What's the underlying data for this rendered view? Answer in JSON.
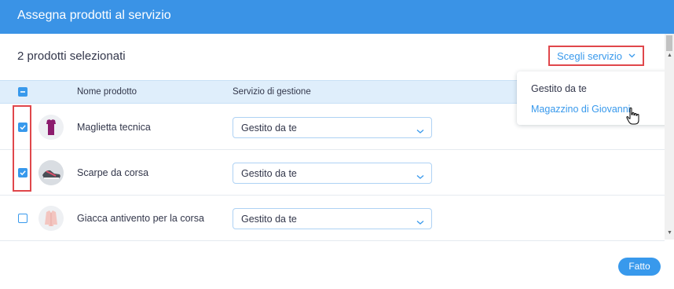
{
  "dialog": {
    "title": "Assegna prodotti al servizio",
    "selected_count": "2 prodotti selezionati",
    "choose_service_label": "Scegli servizio",
    "done_label": "Fatto"
  },
  "dropdown": {
    "options": [
      "Gestito da te",
      "Magazzino di Giovanni"
    ],
    "hovered": "Magazzino di Giovanni"
  },
  "table": {
    "headers": {
      "product": "Nome prodotto",
      "service": "Servizio di gestione"
    },
    "header_checkbox_state": "indeterminate",
    "rows": [
      {
        "name": "Maglietta tecnica",
        "service": "Gestito da te",
        "checked": true,
        "thumb_icon": "tshirt-icon"
      },
      {
        "name": "Scarpe da corsa",
        "service": "Gestito da te",
        "checked": true,
        "thumb_icon": "shoes-icon"
      },
      {
        "name": "Giacca antivento per la corsa",
        "service": "Gestito da te",
        "checked": false,
        "thumb_icon": "jacket-icon"
      }
    ]
  },
  "colors": {
    "header_bar": "#3a93e6",
    "accent": "#3899ec",
    "highlight_box": "#e0474b",
    "table_header_bg": "#dfeefb"
  }
}
